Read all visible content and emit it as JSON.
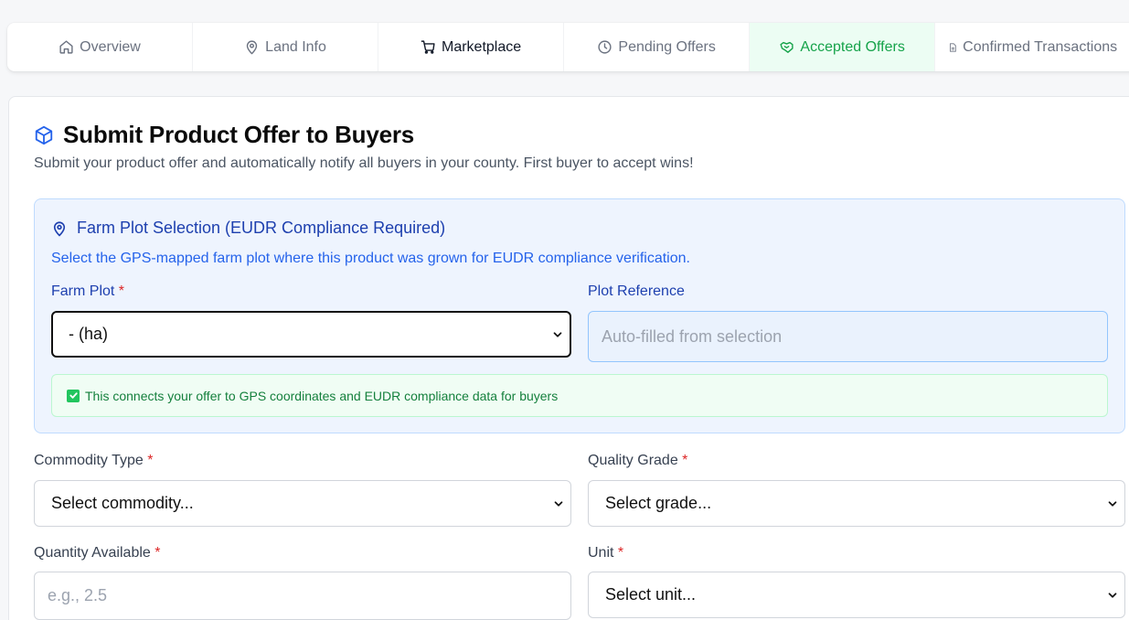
{
  "tabs": [
    {
      "label": "Overview",
      "icon": "home-icon"
    },
    {
      "label": "Land Info",
      "icon": "map-pin-icon"
    },
    {
      "label": "Marketplace",
      "icon": "cart-icon"
    },
    {
      "label": "Pending Offers",
      "icon": "clock-icon"
    },
    {
      "label": "Accepted Offers",
      "icon": "handshake-icon"
    },
    {
      "label": "Confirmed Transactions",
      "icon": "document-icon"
    }
  ],
  "page": {
    "title": "Submit Product Offer to Buyers",
    "subtitle": "Submit your product offer and automatically notify all buyers in your county. First buyer to accept wins!"
  },
  "plot_section": {
    "title": "Farm Plot Selection (EUDR Compliance Required)",
    "description": "Select the GPS-mapped farm plot where this product was grown for EUDR compliance verification.",
    "farm_plot_label": "Farm Plot",
    "farm_plot_value": "- (ha)",
    "plot_ref_label": "Plot Reference",
    "plot_ref_placeholder": "Auto-filled from selection",
    "notice": "This connects your offer to GPS coordinates and EUDR compliance data for buyers"
  },
  "form": {
    "commodity_label": "Commodity Type",
    "commodity_value": "Select commodity...",
    "grade_label": "Quality Grade",
    "grade_value": "Select grade...",
    "quantity_label": "Quantity Available",
    "quantity_placeholder": "e.g., 2.5",
    "unit_label": "Unit",
    "unit_value": "Select unit..."
  },
  "required_mark": "*",
  "colors": {
    "accent_blue": "#2563eb",
    "accent_green": "#16a34a",
    "required_red": "#dc2626"
  }
}
